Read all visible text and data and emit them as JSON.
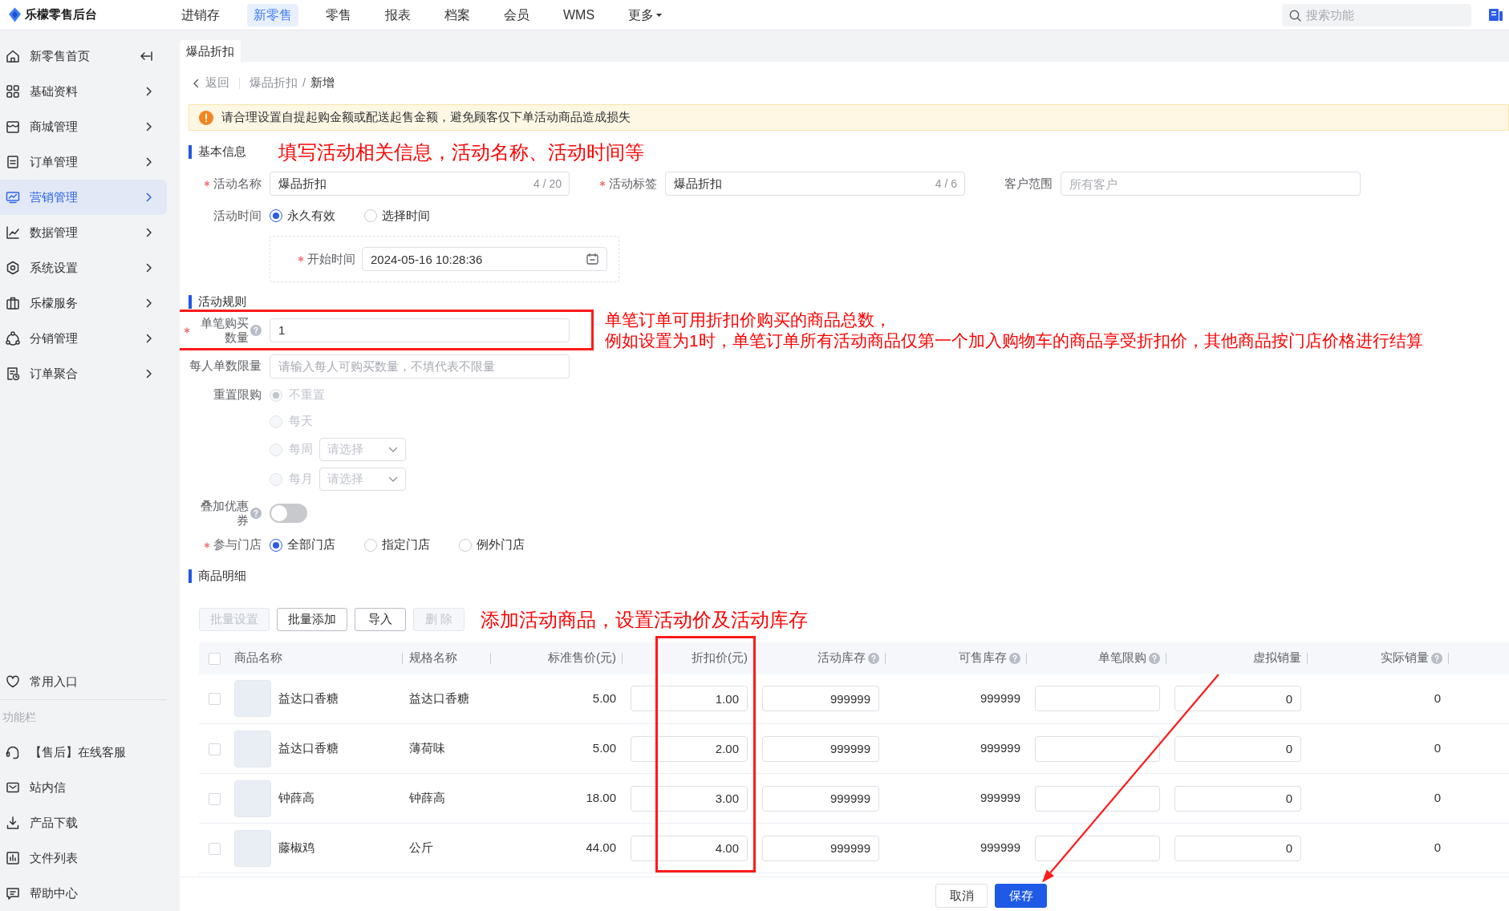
{
  "header": {
    "logo_text": "乐檬零售后台",
    "nav": [
      {
        "label": "进销存",
        "selected": false,
        "kind": "link"
      },
      {
        "label": "新零售",
        "selected": true,
        "kind": "link"
      },
      {
        "label": "零售",
        "selected": false,
        "kind": "link"
      },
      {
        "label": "报表",
        "selected": false,
        "kind": "link"
      },
      {
        "label": "档案",
        "selected": false,
        "kind": "link"
      },
      {
        "label": "会员",
        "selected": false,
        "kind": "link"
      },
      {
        "label": "WMS",
        "selected": false,
        "kind": "link"
      },
      {
        "label": "更多",
        "selected": false,
        "kind": "dropdown"
      }
    ],
    "search": {
      "placeholder": "搜索功能"
    }
  },
  "sidebar": {
    "items": [
      {
        "label": "新零售首页",
        "selected": false,
        "kind": "page"
      },
      {
        "label": "基础资料",
        "selected": false,
        "kind": "group"
      },
      {
        "label": "商城管理",
        "selected": false,
        "kind": "group"
      },
      {
        "label": "订单管理",
        "selected": false,
        "kind": "group"
      },
      {
        "label": "营销管理",
        "selected": true,
        "kind": "group"
      },
      {
        "label": "数据管理",
        "selected": false,
        "kind": "group"
      },
      {
        "label": "系统设置",
        "selected": false,
        "kind": "group"
      },
      {
        "label": "乐檬服务",
        "selected": false,
        "kind": "group"
      },
      {
        "label": "分销管理",
        "selected": false,
        "kind": "group"
      },
      {
        "label": "订单聚合",
        "selected": false,
        "kind": "group"
      }
    ],
    "favorites": {
      "label": "常用入口"
    },
    "tools_title": "功能栏",
    "tools": [
      {
        "label": "【售后】在线客服"
      },
      {
        "label": "站内信"
      },
      {
        "label": "产品下载"
      },
      {
        "label": "文件列表"
      },
      {
        "label": "帮助中心"
      }
    ]
  },
  "tabs": [
    {
      "label": "爆品折扣",
      "selected": true
    }
  ],
  "breadcrumb": {
    "back": "返回",
    "items": [
      "爆品折扣",
      "新增"
    ],
    "separator": "/"
  },
  "alert": {
    "text": "请合理设置自提起购金额或配送起售金额，避免顾客仅下单活动商品造成损失"
  },
  "basic_info": {
    "title": "基本信息",
    "note": "填写活动相关信息，活动名称、活动时间等",
    "fields": [
      {
        "label": "活动名称",
        "required": true,
        "value": "爆品折扣",
        "counter": "4 / 20"
      },
      {
        "label": "活动标签",
        "required": true,
        "value": "爆品折扣",
        "counter": "4 / 6"
      },
      {
        "label": "客户范围",
        "required": false,
        "placeholder": "所有客户"
      }
    ],
    "time": {
      "label": "活动时间",
      "options": [
        {
          "label": "永久有效",
          "selected": true
        },
        {
          "label": "选择时间",
          "selected": false
        }
      ],
      "start": {
        "label": "开始时间",
        "required": true,
        "value": "2024-05-16 10:28:36"
      }
    }
  },
  "rules": {
    "title": "活动规则",
    "fields": [
      {
        "kind": "input",
        "label": "单笔购买数量",
        "required": true,
        "help": true,
        "highlighted": true,
        "value": "1",
        "note": [
          "单笔订单可用折扣价购买的商品总数，",
          "例如设置为1时，单笔订单所有活动商品仅第一个加入购物车的商品享受折扣价，其他商品按门店价格进行结算"
        ]
      },
      {
        "kind": "input",
        "label": "每人单数限量",
        "required": false,
        "help": false,
        "highlighted": false,
        "placeholder": "请输入每人可购买数量，不填代表不限量"
      },
      {
        "kind": "radio-list",
        "label": "重置限购",
        "required": false,
        "help": false,
        "highlighted": false,
        "options": [
          {
            "label": "不重置",
            "selected": true,
            "disabled": true
          },
          {
            "label": "每天",
            "selected": false,
            "disabled": true
          },
          {
            "label": "每周",
            "selected": false,
            "disabled": true,
            "select_placeholder": "请选择"
          },
          {
            "label": "每月",
            "selected": false,
            "disabled": true,
            "select_placeholder": "请选择"
          }
        ]
      },
      {
        "kind": "switch",
        "label": "叠加优惠券",
        "required": false,
        "help": true,
        "highlighted": false,
        "on": false
      },
      {
        "kind": "radio-row",
        "label": "参与门店",
        "required": true,
        "help": false,
        "highlighted": false,
        "options": [
          {
            "label": "全部门店",
            "selected": true
          },
          {
            "label": "指定门店",
            "selected": false
          },
          {
            "label": "例外门店",
            "selected": false
          }
        ]
      }
    ]
  },
  "goods": {
    "title": "商品明细",
    "buttons": [
      {
        "label": "批量设置",
        "disabled": true
      },
      {
        "label": "批量添加",
        "disabled": false
      },
      {
        "label": "导入",
        "disabled": false
      },
      {
        "label": "删 除",
        "disabled": true
      }
    ],
    "note": "添加活动商品，设置活动价及活动库存",
    "table": {
      "all_checked": false,
      "columns": [
        {
          "label": "商品名称",
          "help": false,
          "highlighted": false
        },
        {
          "label": "规格名称",
          "help": false,
          "highlighted": false
        },
        {
          "label": "标准售价(元)",
          "help": false,
          "highlighted": false
        },
        {
          "label": "折扣价(元)",
          "help": false,
          "highlighted": true
        },
        {
          "label": "活动库存",
          "help": true,
          "highlighted": false
        },
        {
          "label": "可售库存",
          "help": true,
          "highlighted": false
        },
        {
          "label": "单笔限购",
          "help": true,
          "highlighted": false
        },
        {
          "label": "虚拟销量",
          "help": false,
          "highlighted": false
        },
        {
          "label": "实际销量",
          "help": true,
          "highlighted": false
        }
      ],
      "rows": [
        {
          "selected": false,
          "name": "益达口香糖",
          "spec": "益达口香糖",
          "price": "5.00",
          "discount_price": "1.00",
          "activity_stock": "999999",
          "available_stock": "999999",
          "virtual_sales": "0",
          "actual_sales": "0"
        },
        {
          "selected": false,
          "name": "益达口香糖",
          "spec": "薄荷味",
          "price": "5.00",
          "discount_price": "2.00",
          "activity_stock": "999999",
          "available_stock": "999999",
          "virtual_sales": "0",
          "actual_sales": "0"
        },
        {
          "selected": false,
          "name": "钟薛高",
          "spec": "钟薛高",
          "price": "18.00",
          "discount_price": "3.00",
          "activity_stock": "999999",
          "available_stock": "999999",
          "virtual_sales": "0",
          "actual_sales": "0"
        },
        {
          "selected": false,
          "name": "藤椒鸡",
          "spec": "公斤",
          "price": "44.00",
          "discount_price": "4.00",
          "activity_stock": "999999",
          "available_stock": "999999",
          "virtual_sales": "0",
          "actual_sales": "0"
        }
      ]
    }
  },
  "footer": {
    "buttons": [
      {
        "label": "取消",
        "kind": "default"
      },
      {
        "label": "保存",
        "kind": "primary"
      }
    ]
  }
}
